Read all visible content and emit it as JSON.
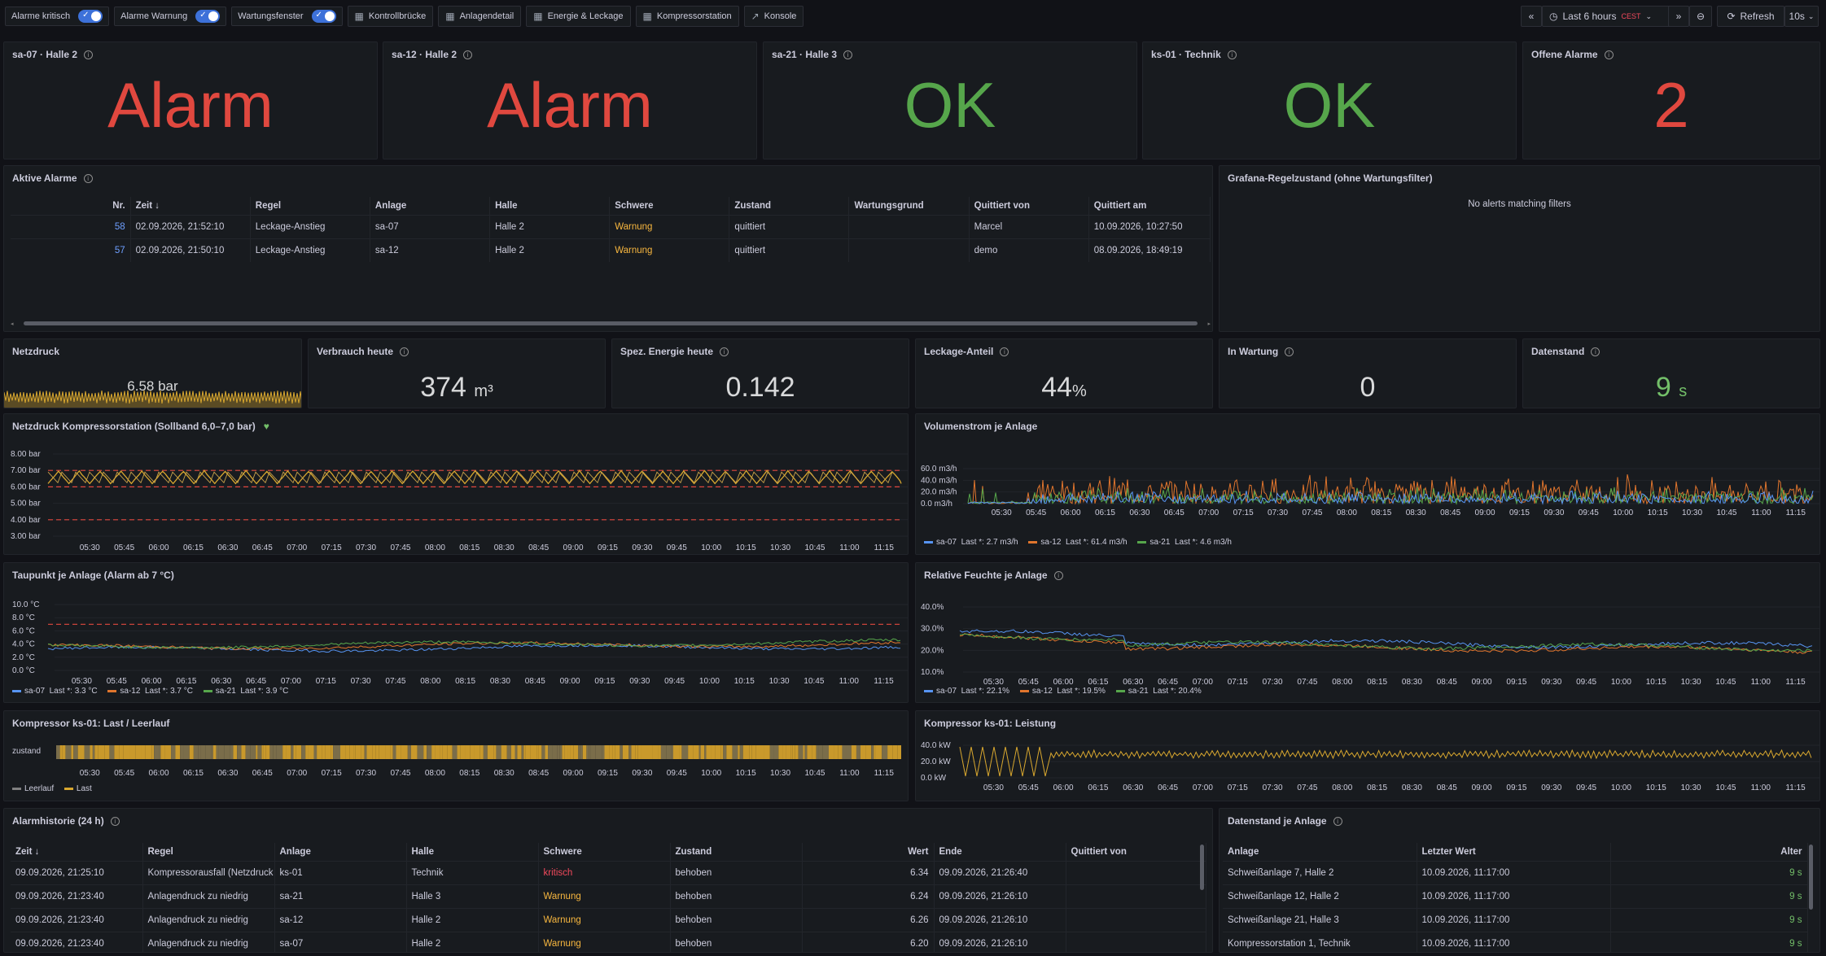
{
  "topbar": {
    "toggles": [
      {
        "label": "Alarme kritisch"
      },
      {
        "label": "Alarme Warnung"
      },
      {
        "label": "Wartungsfenster"
      }
    ],
    "links": [
      {
        "label": "Kontrollbrücke"
      },
      {
        "label": "Anlagendetail"
      },
      {
        "label": "Energie & Leckage"
      },
      {
        "label": "Kompressorstation"
      },
      {
        "label": "Konsole"
      }
    ],
    "time_range": "Last 6 hours",
    "timezone": "CEST",
    "refresh_label": "Refresh",
    "refresh_interval": "10s"
  },
  "status_panels": [
    {
      "title": "sa-07 · Halle 2",
      "value": "Alarm",
      "color": "#e0483f"
    },
    {
      "title": "sa-12 · Halle 2",
      "value": "Alarm",
      "color": "#e0483f"
    },
    {
      "title": "sa-21 · Halle 3",
      "value": "OK",
      "color": "#56a64b"
    },
    {
      "title": "ks-01 · Technik",
      "value": "OK",
      "color": "#56a64b"
    },
    {
      "title": "Offene Alarme",
      "value": "2",
      "color": "#e0483f"
    }
  ],
  "active_alarms": {
    "title": "Aktive Alarme",
    "columns": [
      "Nr.",
      "Zeit",
      "Regel",
      "Anlage",
      "Halle",
      "Schwere",
      "Zustand",
      "Wartungsgrund",
      "Quittiert von",
      "Quittiert am"
    ],
    "rows": [
      [
        "58",
        "02.09.2026, 21:52:10",
        "Leckage-Anstieg",
        "sa-07",
        "Halle 2",
        "Warnung",
        "quittiert",
        "",
        "Marcel",
        "10.09.2026, 10:27:50"
      ],
      [
        "57",
        "02.09.2026, 21:50:10",
        "Leckage-Anstieg",
        "sa-12",
        "Halle 2",
        "Warnung",
        "quittiert",
        "",
        "demo",
        "08.09.2026, 18:49:19"
      ]
    ]
  },
  "grafana_rules": {
    "title": "Grafana-Regelzustand (ohne Wartungsfilter)",
    "empty_text": "No alerts matching filters"
  },
  "netzdruck": {
    "title": "Netzdruck",
    "value": "6.58 bar"
  },
  "stats": [
    {
      "title": "Verbrauch heute",
      "value": "374",
      "unit": "m³",
      "color": "#d8d9da"
    },
    {
      "title": "Spez. Energie heute",
      "value": "0.142",
      "unit": "",
      "color": "#d8d9da"
    },
    {
      "title": "Leckage-Anteil",
      "value": "44",
      "unit": "%",
      "color": "#d8d9da"
    },
    {
      "title": "In Wartung",
      "value": "0",
      "unit": "",
      "color": "#d8d9da"
    },
    {
      "title": "Datenstand",
      "value": "9",
      "unit": "s",
      "color": "#73bf69"
    }
  ],
  "time_ticks": [
    "05:30",
    "05:45",
    "06:00",
    "06:15",
    "06:30",
    "06:45",
    "07:00",
    "07:15",
    "07:30",
    "07:45",
    "08:00",
    "08:15",
    "08:30",
    "08:45",
    "09:00",
    "09:15",
    "09:30",
    "09:45",
    "10:00",
    "10:15",
    "10:30",
    "10:45",
    "11:00",
    "11:15"
  ],
  "chart_data": [
    {
      "type": "line",
      "title": "Netzdruck Kompressorstation (Sollband 6,0–7,0 bar)",
      "y_ticks": [
        "8.00 bar",
        "7.00 bar",
        "6.00 bar",
        "5.00 bar",
        "4.00 bar",
        "3.00 bar"
      ],
      "ylim": [
        3,
        8
      ],
      "thresholds": [
        {
          "value": 7.0,
          "color": "#e0483f"
        },
        {
          "value": 6.0,
          "color": "#e0483f"
        },
        {
          "value": 4.0,
          "color": "#e0483f"
        }
      ],
      "series": [
        {
          "values_range": [
            6.2,
            7.0
          ],
          "color": "#d8a72f"
        }
      ]
    },
    {
      "type": "line",
      "title": "Volumenstrom je Anlage",
      "y_ticks": [
        "60.0 m3/h",
        "40.0 m3/h",
        "20.0 m3/h",
        "0.0 m3/h"
      ],
      "ylim": [
        0,
        60
      ],
      "series": [
        {
          "name": "sa-07",
          "last": "Last *: 2.7 m3/h",
          "color": "#5794f2"
        },
        {
          "name": "sa-12",
          "last": "Last *: 61.4 m3/h",
          "color": "#e0752d"
        },
        {
          "name": "sa-21",
          "last": "Last *: 4.6 m3/h",
          "color": "#56a64b"
        }
      ]
    },
    {
      "type": "line",
      "title": "Taupunkt je Anlage (Alarm ab 7 °C)",
      "y_ticks": [
        "10.0 °C",
        "8.0 °C",
        "6.0 °C",
        "4.0 °C",
        "2.0 °C",
        "0.0 °C"
      ],
      "ylim": [
        0,
        10
      ],
      "thresholds": [
        {
          "value": 7.0,
          "color": "#e0483f"
        }
      ],
      "series": [
        {
          "name": "sa-07",
          "last": "Last *: 3.3 °C",
          "color": "#5794f2"
        },
        {
          "name": "sa-12",
          "last": "Last *: 3.7 °C",
          "color": "#e0752d"
        },
        {
          "name": "sa-21",
          "last": "Last *: 3.9 °C",
          "color": "#56a64b"
        }
      ]
    },
    {
      "type": "line",
      "title": "Relative Feuchte je Anlage",
      "y_ticks": [
        "40.0%",
        "30.0%",
        "20.0%",
        "10.0%"
      ],
      "ylim": [
        10,
        40
      ],
      "series": [
        {
          "name": "sa-07",
          "last": "Last *: 22.1%",
          "color": "#5794f2"
        },
        {
          "name": "sa-12",
          "last": "Last *: 19.5%",
          "color": "#e0752d"
        },
        {
          "name": "sa-21",
          "last": "Last *: 20.4%",
          "color": "#56a64b"
        }
      ]
    },
    {
      "type": "heatmap",
      "title": "Kompressor ks-01: Last / Leerlauf",
      "row_label": "zustand",
      "series": [
        {
          "name": "Leerlauf",
          "color": "#808080"
        },
        {
          "name": "Last",
          "color": "#d8a72f"
        }
      ]
    },
    {
      "type": "line",
      "title": "Kompressor ks-01: Leistung",
      "y_ticks": [
        "40.0 kW",
        "20.0 kW",
        "0.0 kW"
      ],
      "ylim": [
        0,
        40
      ],
      "series": [
        {
          "color": "#d8a72f"
        }
      ]
    }
  ],
  "alarm_history": {
    "title": "Alarmhistorie (24 h)",
    "columns": [
      "Zeit",
      "Regel",
      "Anlage",
      "Halle",
      "Schwere",
      "Zustand",
      "Wert",
      "Ende",
      "Quittiert von"
    ],
    "rows": [
      [
        "09.09.2026, 21:25:10",
        "Kompressorausfall (Netzdruck",
        "ks-01",
        "Technik",
        "kritisch",
        "behoben",
        "6.34",
        "09.09.2026, 21:26:40",
        ""
      ],
      [
        "09.09.2026, 21:23:40",
        "Anlagendruck zu niedrig",
        "sa-21",
        "Halle 3",
        "Warnung",
        "behoben",
        "6.24",
        "09.09.2026, 21:26:10",
        ""
      ],
      [
        "09.09.2026, 21:23:40",
        "Anlagendruck zu niedrig",
        "sa-12",
        "Halle 2",
        "Warnung",
        "behoben",
        "6.26",
        "09.09.2026, 21:26:10",
        ""
      ],
      [
        "09.09.2026, 21:23:40",
        "Anlagendruck zu niedrig",
        "sa-07",
        "Halle 2",
        "Warnung",
        "behoben",
        "6.20",
        "09.09.2026, 21:26:10",
        ""
      ]
    ]
  },
  "datenstand": {
    "title": "Datenstand je Anlage",
    "columns": [
      "Anlage",
      "Letzter Wert",
      "Alter"
    ],
    "rows": [
      [
        "Schweißanlage 7, Halle 2",
        "10.09.2026, 11:17:00",
        "9 s"
      ],
      [
        "Schweißanlage 12, Halle 2",
        "10.09.2026, 11:17:00",
        "9 s"
      ],
      [
        "Schweißanlage 21, Halle 3",
        "10.09.2026, 11:17:00",
        "9 s"
      ],
      [
        "Kompressorstation 1, Technik",
        "10.09.2026, 11:17:00",
        "9 s"
      ]
    ]
  }
}
